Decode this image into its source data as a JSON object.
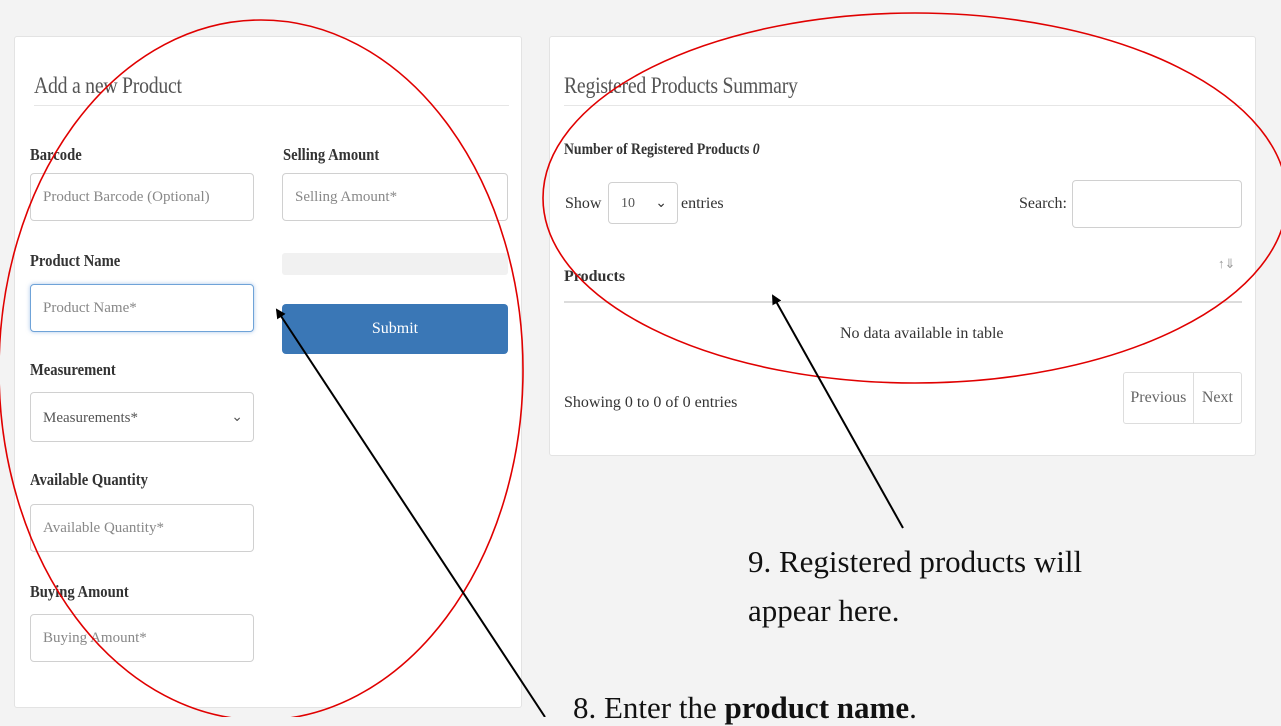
{
  "left_panel": {
    "title": "Add a new Product",
    "barcode": {
      "label": "Barcode",
      "placeholder": "Product Barcode (Optional)"
    },
    "selling_amount": {
      "label": "Selling Amount",
      "placeholder": "Selling Amount*"
    },
    "product_name": {
      "label": "Product Name",
      "placeholder": "Product Name*"
    },
    "submit_label": "Submit",
    "measurement": {
      "label": "Measurement",
      "selected": "Measurements*"
    },
    "available_quantity": {
      "label": "Available Quantity",
      "placeholder": "Available Quantity*"
    },
    "buying_amount": {
      "label": "Buying Amount",
      "placeholder": "Buying Amount*"
    }
  },
  "right_panel": {
    "title": "Registered Products Summary",
    "count_label": "Number of Registered Products",
    "count_value": "0",
    "show_label": "Show",
    "entries_value": "10",
    "entries_label": "entries",
    "search_label": "Search:",
    "search_value": "",
    "table_header": "Products",
    "empty_message": "No data available in table",
    "info": "Showing 0 to 0 of 0 entries",
    "prev_label": "Previous",
    "next_label": "Next"
  },
  "annotations": {
    "note9_line1": "9. Registered products will",
    "note9_line2": "appear here.",
    "note8_prefix": "8. Enter the ",
    "note8_bold": "product name",
    "note8_suffix": "."
  },
  "icons": {
    "select_chevron": "chevron-down-icon",
    "sort": "sort-icon"
  },
  "colors": {
    "primary_button": "#3a77b6",
    "focus_border": "#6fa3d8",
    "annotation_ellipse": "#e00000",
    "arrow": "#000000"
  }
}
